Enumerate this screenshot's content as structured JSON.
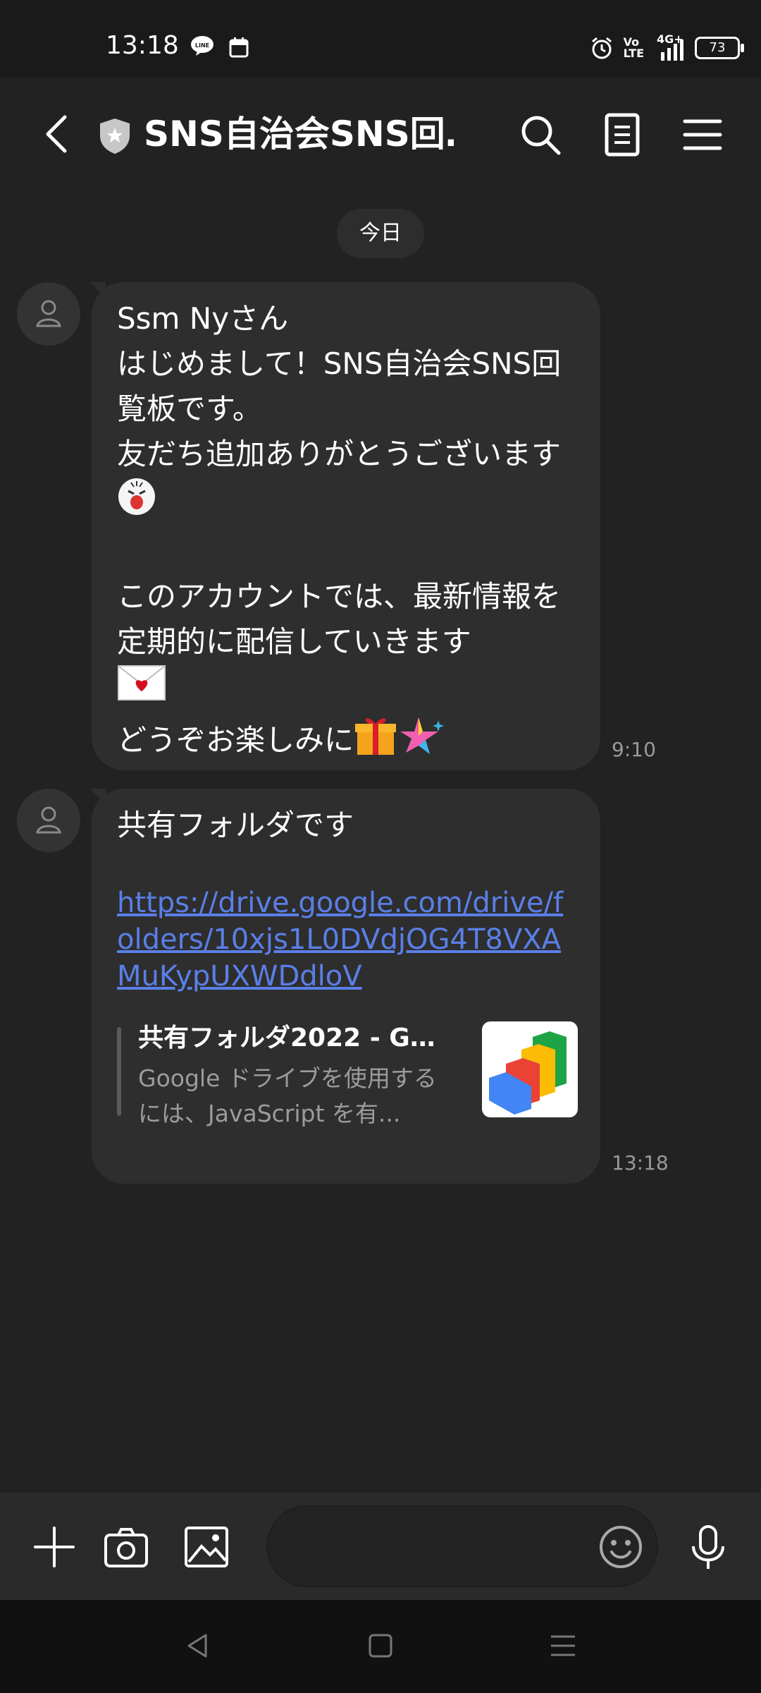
{
  "status_bar": {
    "time": "13:18",
    "battery": "73",
    "network": "4G+",
    "volte": "Vo LTE"
  },
  "header": {
    "title": "SNS自治会SNS回…"
  },
  "chat": {
    "date_label": "今日",
    "messages": [
      {
        "text": "Ssm Nyさん\nはじめまして！SNS自治会SNS回覧板です。\n友だち追加ありがとうございます",
        "text2": "\n\nこのアカウントでは、最新情報を定期的に配信していきます",
        "text3": "どうぞお楽しみに",
        "time": "9:10"
      },
      {
        "text": "共有フォルダです",
        "link": "https://drive.google.com/drive/folders/10xjs1L0DVdjOG4T8VXAMuKypUXWDdloV",
        "preview_title": "共有フォルダ2022 - Go...",
        "preview_desc": "Google ドライブを使用するには、JavaScript を有...",
        "time": "13:18"
      }
    ]
  },
  "input": {
    "placeholder": ""
  },
  "icons": {
    "back": "back-arrow-icon",
    "shield": "official-account-shield-icon",
    "search": "search-icon",
    "notes": "notes-icon",
    "menu": "menu-icon",
    "plus": "plus-icon",
    "camera": "camera-icon",
    "image": "image-icon",
    "emoji": "emoji-icon",
    "mic": "microphone-icon"
  },
  "colors": {
    "background": "#222222",
    "bubble": "#2e2e2e",
    "link": "#5a7fe8"
  }
}
